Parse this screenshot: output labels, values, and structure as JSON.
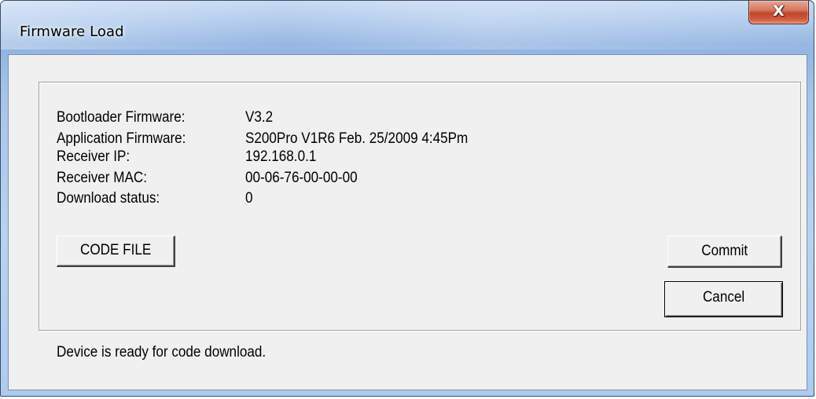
{
  "window": {
    "title": "Firmware Load",
    "close_label": "X",
    "accent_color": "#c0452b"
  },
  "info": [
    {
      "label": "Bootloader Firmware:",
      "value": "V3.2"
    },
    {
      "label": "Application Firmware:",
      "value": "S200Pro V1R6 Feb. 25/2009 4:45Pm"
    },
    {
      "label": "Receiver IP:",
      "value": "192.168.0.1"
    },
    {
      "label": "Receiver MAC:",
      "value": "00-06-76-00-00-00"
    },
    {
      "label": "Download status:",
      "value": "0"
    }
  ],
  "buttons": {
    "code_file": "CODE FILE",
    "commit": "Commit",
    "cancel": "Cancel"
  },
  "status": {
    "message": "Device is ready for code download."
  }
}
